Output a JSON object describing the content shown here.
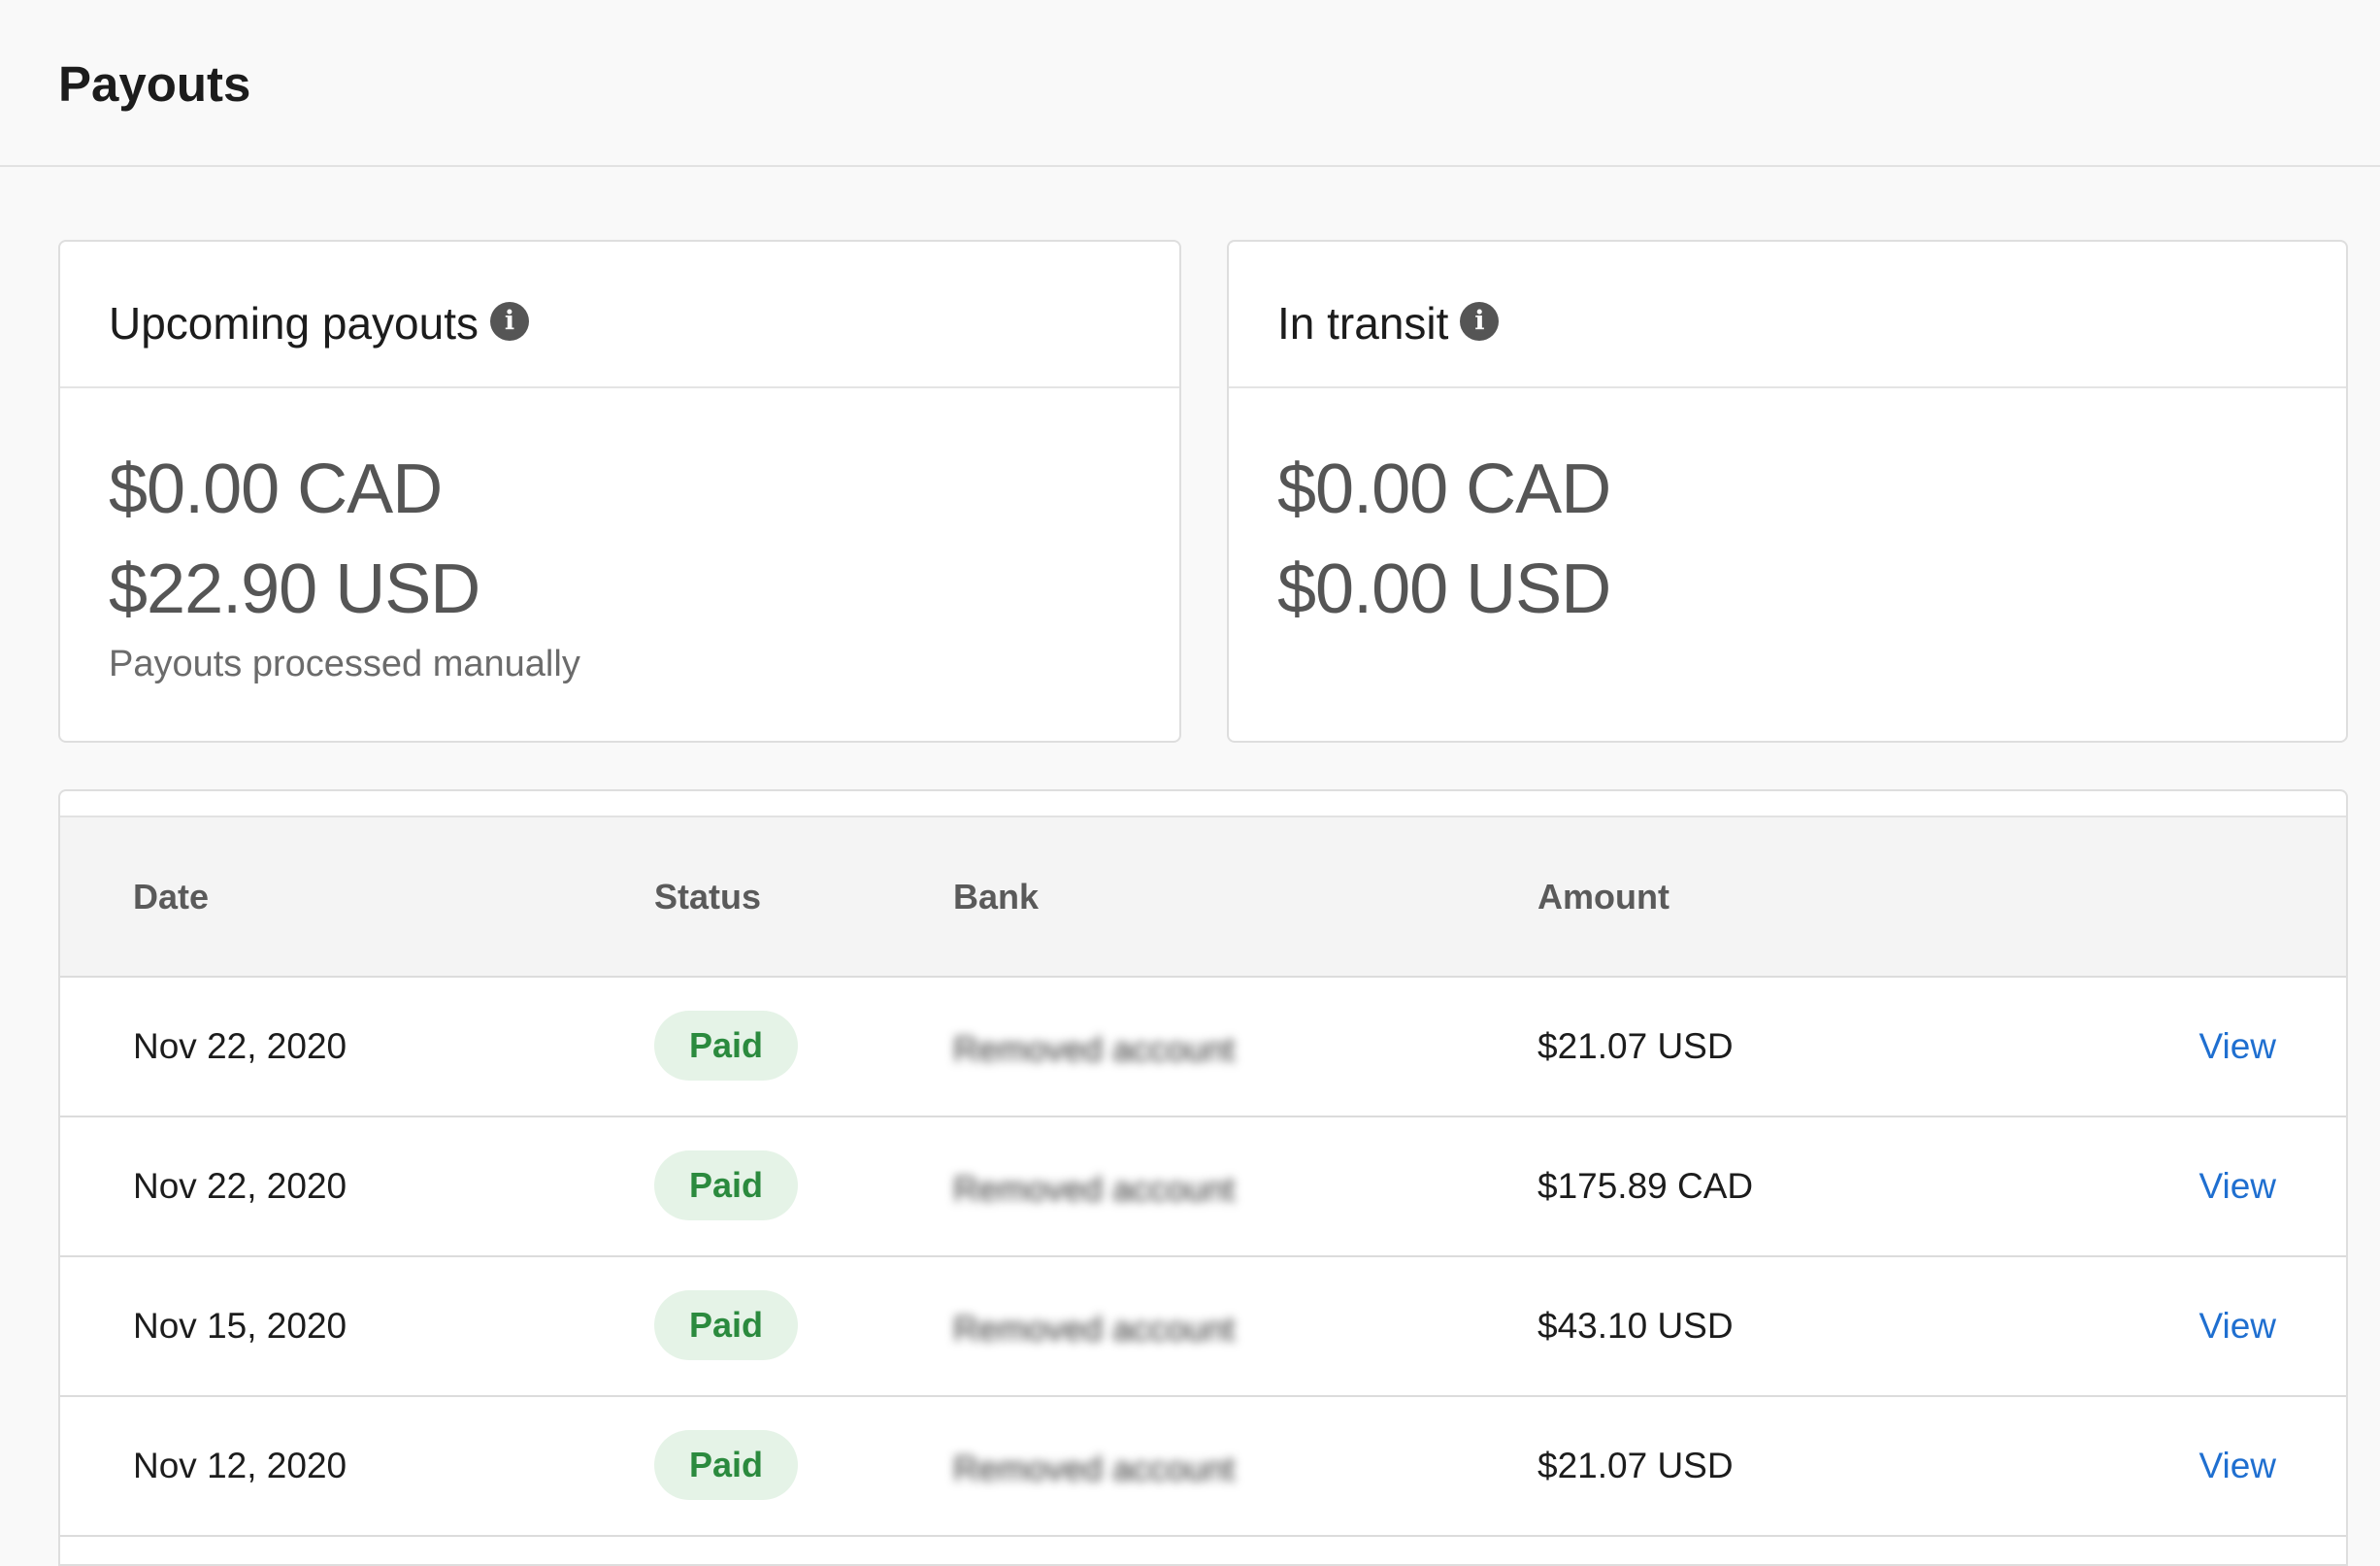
{
  "header": {
    "title": "Payouts"
  },
  "upcoming": {
    "title": "Upcoming payouts",
    "info_icon": "info-icon",
    "amount_cad": "$0.00 CAD",
    "amount_usd": "$22.90 USD",
    "note": "Payouts processed manually"
  },
  "transit": {
    "title": "In transit",
    "info_icon": "info-icon",
    "amount_cad": "$0.00 CAD",
    "amount_usd": "$0.00 USD"
  },
  "table": {
    "columns": {
      "date": "Date",
      "status": "Status",
      "bank": "Bank",
      "amount": "Amount"
    },
    "rows": [
      {
        "date": "Nov 22, 2020",
        "status": "Paid",
        "bank": "Removed account",
        "amount": "$21.07 USD",
        "action": "View"
      },
      {
        "date": "Nov 22, 2020",
        "status": "Paid",
        "bank": "Removed account",
        "amount": "$175.89 CAD",
        "action": "View"
      },
      {
        "date": "Nov 15, 2020",
        "status": "Paid",
        "bank": "Removed account",
        "amount": "$43.10 USD",
        "action": "View"
      },
      {
        "date": "Nov 12, 2020",
        "status": "Paid",
        "bank": "Removed account",
        "amount": "$21.07 USD",
        "action": "View"
      }
    ]
  },
  "colors": {
    "background": "#f9f9f9",
    "paid_badge_bg": "#e5f3e7",
    "paid_badge_text": "#2b8a3e",
    "link": "#1f6fd0"
  }
}
